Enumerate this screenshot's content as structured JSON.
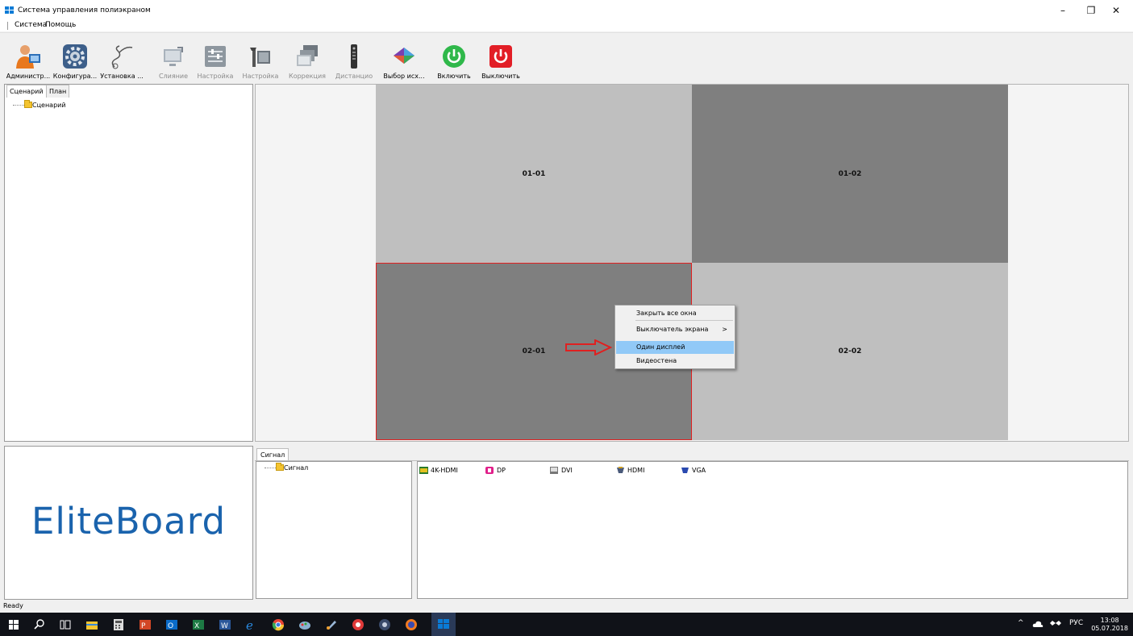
{
  "window": {
    "title": "Система управления полиэкраном",
    "menu": [
      "Система",
      "Помощь"
    ],
    "controls": {
      "minimize": "–",
      "restore": "❐",
      "close": "✕"
    }
  },
  "toolbar": {
    "items": [
      {
        "label": "Администр...",
        "icon": "admin-user-icon",
        "enabled": true
      },
      {
        "label": "Конфигура...",
        "icon": "gear-config-icon",
        "enabled": true
      },
      {
        "label": "Установка ...",
        "icon": "install-cable-icon",
        "enabled": true
      },
      {
        "label": "Слияние",
        "icon": "merge-monitor-icon",
        "enabled": false
      },
      {
        "label": "Настройка",
        "icon": "settings-sliders-icon",
        "enabled": false
      },
      {
        "label": "Настройка",
        "icon": "settings-tools-icon",
        "enabled": false
      },
      {
        "label": "Коррекция",
        "icon": "correction-icon",
        "enabled": false
      },
      {
        "label": "Дистанцио",
        "icon": "remote-control-icon",
        "enabled": false
      },
      {
        "label": "Выбор исх...",
        "icon": "source-select-icon",
        "enabled": true
      },
      {
        "label": "Включить",
        "icon": "power-on-icon",
        "enabled": true
      },
      {
        "label": "Выключить",
        "icon": "power-off-icon",
        "enabled": true
      }
    ]
  },
  "leftpane": {
    "tabs": [
      "Сценарий",
      "План"
    ],
    "tree_root": "Сценарий"
  },
  "wall": {
    "cells": [
      "01-01",
      "01-02",
      "02-01",
      "02-02"
    ]
  },
  "context_menu": {
    "items": [
      "Закрыть все окна",
      "Выключатель экрана",
      "Один дисплей",
      "Видеостена"
    ],
    "submenu_arrow": ">",
    "highlighted": "Один дисплей"
  },
  "logo": {
    "text": "EliteBoard",
    "color": "#1a63ad"
  },
  "signal": {
    "tab": "Сигнал",
    "tree_root": "Сигнал",
    "sources": [
      "4K-HDMI",
      "DP",
      "DVI",
      "HDMI",
      "VGA"
    ]
  },
  "status": {
    "text": "Ready"
  },
  "taskbar": {
    "tray_lang": "РУС",
    "tray_up": "^",
    "time": "13:08",
    "date": "05.07.2018"
  }
}
